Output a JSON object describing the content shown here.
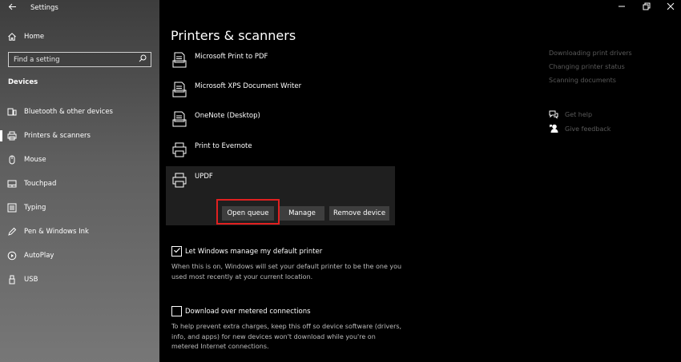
{
  "window": {
    "app_title": "Settings",
    "back_icon": "back-arrow-icon",
    "controls": [
      "minimize-icon",
      "restore-icon",
      "close-icon"
    ]
  },
  "sidebar": {
    "home_label": "Home",
    "search_placeholder": "Find a setting",
    "section_header": "Devices",
    "items": [
      {
        "label": "Bluetooth & other devices",
        "icon": "bluetooth-devices-icon"
      },
      {
        "label": "Printers & scanners",
        "icon": "printer-icon",
        "active": true
      },
      {
        "label": "Mouse",
        "icon": "mouse-icon"
      },
      {
        "label": "Touchpad",
        "icon": "touchpad-icon"
      },
      {
        "label": "Typing",
        "icon": "keyboard-icon"
      },
      {
        "label": "Pen & Windows Ink",
        "icon": "pen-icon"
      },
      {
        "label": "AutoPlay",
        "icon": "autoplay-icon"
      },
      {
        "label": "USB",
        "icon": "usb-icon"
      }
    ]
  },
  "main": {
    "title": "Printers & scanners",
    "printers": [
      {
        "name": "Microsoft Print to PDF",
        "icon": "fax-printer-icon"
      },
      {
        "name": "Microsoft XPS Document Writer",
        "icon": "fax-printer-icon"
      },
      {
        "name": "OneNote (Desktop)",
        "icon": "fax-printer-icon"
      },
      {
        "name": "Print to Evernote",
        "icon": "printer-icon"
      },
      {
        "name": "UPDF",
        "icon": "printer-icon",
        "selected": true
      }
    ],
    "buttons": {
      "open_queue": "Open queue",
      "manage": "Manage",
      "remove_device": "Remove device"
    },
    "default_printer": {
      "label": "Let Windows manage my default printer",
      "checked": true,
      "description": "When this is on, Windows will set your default printer to be the one you used most recently at your current location."
    },
    "metered": {
      "label": "Download over metered connections",
      "checked": false,
      "description": "To help prevent extra charges, keep this off so device software (drivers, info, and apps) for new devices won't download while you're on metered Internet connections."
    }
  },
  "related": {
    "links": [
      "Downloading print drivers",
      "Changing printer status",
      "Scanning documents"
    ],
    "get_help": "Get help",
    "give_feedback": "Give feedback"
  },
  "colors": {
    "highlight": "#e02020",
    "button_bg": "#3e3e3e",
    "selected_row_bg": "#1f1f1f"
  }
}
